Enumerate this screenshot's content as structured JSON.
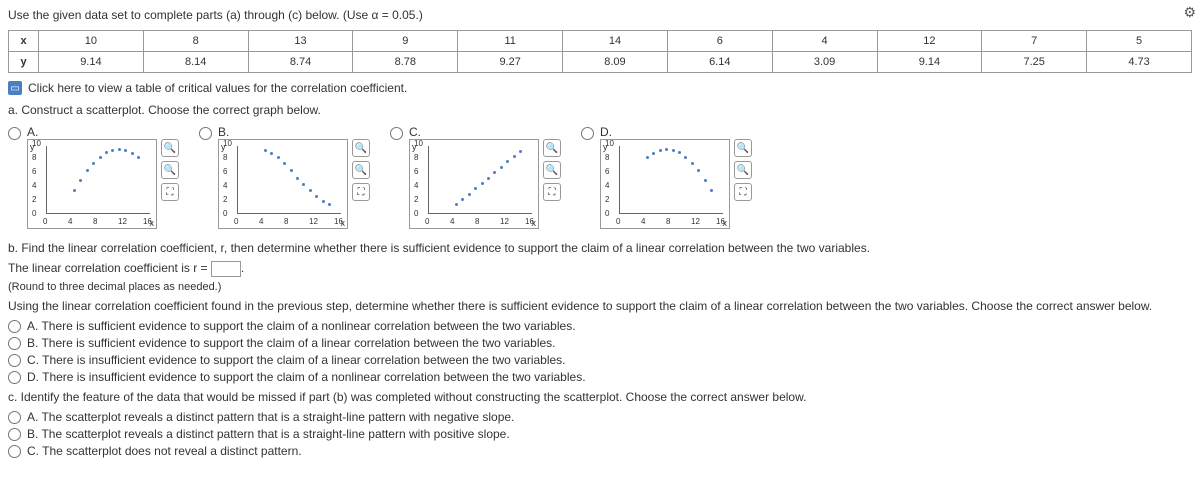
{
  "instruction": "Use the given data set to complete parts (a) through (c) below. (Use α = 0.05.)",
  "table": {
    "rowLabels": [
      "x",
      "y"
    ],
    "x": [
      "10",
      "8",
      "13",
      "9",
      "11",
      "14",
      "6",
      "4",
      "12",
      "7",
      "5"
    ],
    "y": [
      "9.14",
      "8.14",
      "8.74",
      "8.78",
      "9.27",
      "8.09",
      "6.14",
      "3.09",
      "9.14",
      "7.25",
      "4.73"
    ]
  },
  "link": "Click here to view a table of critical values for the correlation coefficient.",
  "partA": {
    "prompt": "a. Construct a scatterplot. Choose the correct graph below.",
    "choices": [
      "A.",
      "B.",
      "C.",
      "D."
    ],
    "axisY": "y",
    "axisX": "x",
    "yTicks": [
      "0",
      "2",
      "4",
      "6",
      "8",
      "10"
    ],
    "xTicks": [
      "0",
      "4",
      "8",
      "12",
      "16"
    ]
  },
  "partB": {
    "prompt": "b. Find the linear correlation coefficient, r, then determine whether there is sufficient evidence to support the claim of a linear correlation between the two variables.",
    "line1_pre": "The linear correlation coefficient is r = ",
    "line1_post": ".",
    "note": "(Round to three decimal places as needed.)",
    "sub": "Using the linear correlation coefficient found in the previous step, determine whether there is sufficient evidence to support the claim of a linear correlation between the two variables. Choose the correct answer below.",
    "options": [
      "A.  There is sufficient evidence to support the claim of a nonlinear correlation between the two variables.",
      "B.  There is sufficient evidence to support the claim of a linear correlation between the two variables.",
      "C.  There is insufficient evidence to support the claim of a linear correlation between the two variables.",
      "D.  There is insufficient evidence to support the claim of a nonlinear correlation between the two variables."
    ]
  },
  "partC": {
    "prompt": "c. Identify the feature of the data that would be missed if part (b) was completed without constructing the scatterplot. Choose the correct answer below.",
    "options": [
      "A.  The scatterplot reveals a distinct pattern that is a straight-line pattern with negative slope.",
      "B.  The scatterplot reveals a distinct pattern that is a straight-line pattern with positive slope.",
      "C.  The scatterplot does not reveal a distinct pattern."
    ]
  },
  "chart_data": [
    {
      "type": "scatter",
      "title": "A",
      "x": [
        4,
        5,
        6,
        7,
        8,
        9,
        10,
        11,
        12,
        13,
        14
      ],
      "y": [
        3.1,
        4.7,
        6.1,
        7.2,
        8.1,
        8.8,
        9.1,
        9.3,
        9.1,
        8.7,
        8.1
      ],
      "xlim": [
        0,
        16
      ],
      "ylim": [
        0,
        10
      ]
    },
    {
      "type": "scatter",
      "title": "B",
      "x": [
        4,
        5,
        6,
        7,
        8,
        9,
        10,
        11,
        12,
        13,
        14
      ],
      "y": [
        9.1,
        8.7,
        8.1,
        7.2,
        6.1,
        5.0,
        4.0,
        3.1,
        2.2,
        1.5,
        1.0
      ],
      "xlim": [
        0,
        16
      ],
      "ylim": [
        0,
        10
      ]
    },
    {
      "type": "scatter",
      "title": "C",
      "x": [
        4,
        5,
        6,
        7,
        8,
        9,
        10,
        11,
        12,
        13,
        14
      ],
      "y": [
        1.0,
        1.8,
        2.6,
        3.4,
        4.2,
        5.0,
        5.8,
        6.6,
        7.4,
        8.2,
        9.0
      ],
      "xlim": [
        0,
        16
      ],
      "ylim": [
        0,
        10
      ]
    },
    {
      "type": "scatter",
      "title": "D",
      "x": [
        4,
        5,
        6,
        7,
        8,
        9,
        10,
        11,
        12,
        13,
        14
      ],
      "y": [
        8.1,
        8.7,
        9.1,
        9.3,
        9.1,
        8.8,
        8.1,
        7.2,
        6.1,
        4.7,
        3.1
      ],
      "xlim": [
        0,
        16
      ],
      "ylim": [
        0,
        10
      ]
    }
  ]
}
